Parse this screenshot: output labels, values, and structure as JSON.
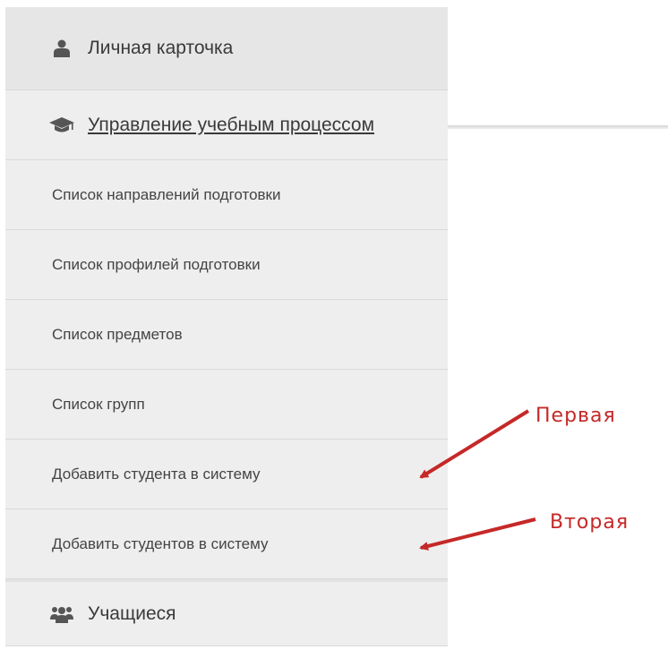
{
  "menu": {
    "profile": {
      "label": "Личная карточка",
      "icon": "user-icon"
    },
    "section": {
      "label": "Управление учебным процессом",
      "icon": "graduation-cap-icon"
    },
    "items": [
      {
        "label": "Список направлений подготовки"
      },
      {
        "label": "Список профилей подготовки"
      },
      {
        "label": "Список предметов"
      },
      {
        "label": "Список групп"
      },
      {
        "label": "Добавить студента в систему"
      },
      {
        "label": "Добавить студентов в систему"
      }
    ],
    "students": {
      "label": "Учащиеся",
      "icon": "users-icon"
    }
  },
  "annotations": {
    "first": "Первая",
    "second": "Вторая",
    "color": "#c62828"
  }
}
